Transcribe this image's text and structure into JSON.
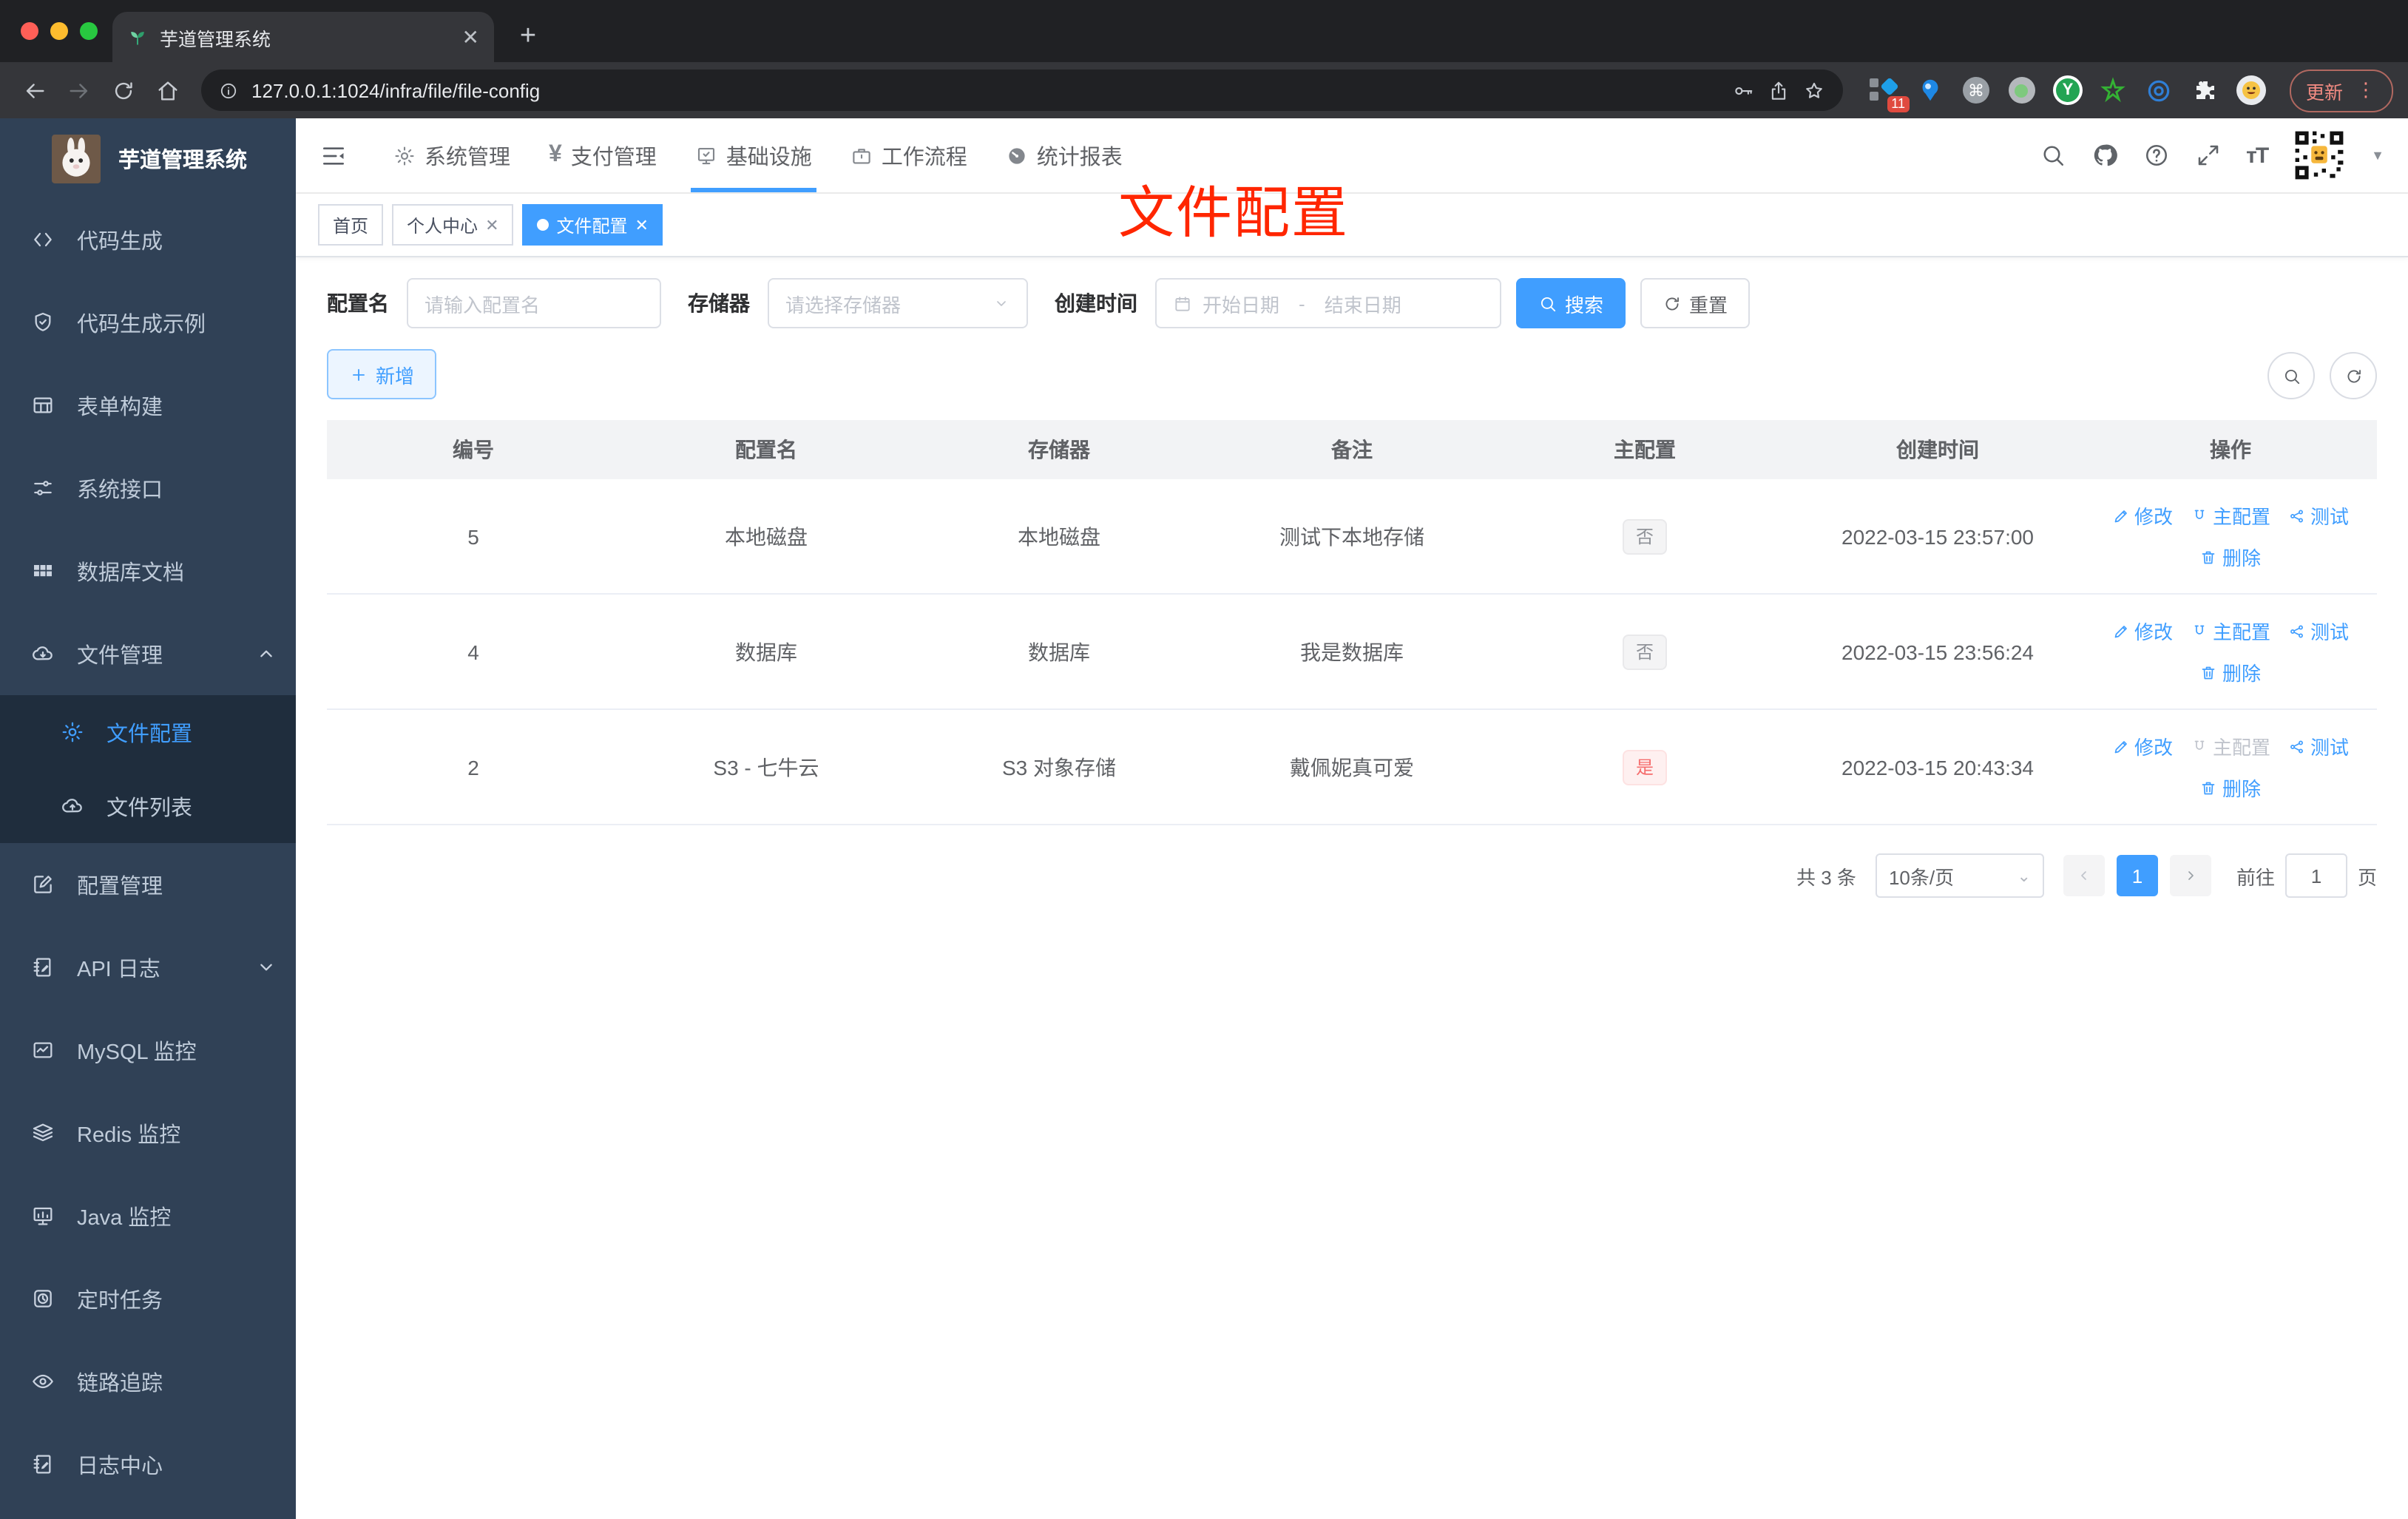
{
  "browser": {
    "tab_title": "芋道管理系统",
    "url": "127.0.0.1:1024/infra/file/file-config",
    "new_tab": "+",
    "extension_badge": "11",
    "update_label": "更新"
  },
  "sidebar": {
    "title": "芋道管理系统",
    "items": [
      {
        "label": "代码生成",
        "icon": "code"
      },
      {
        "label": "代码生成示例",
        "icon": "shield"
      },
      {
        "label": "表单构建",
        "icon": "form"
      },
      {
        "label": "系统接口",
        "icon": "sliders"
      },
      {
        "label": "数据库文档",
        "icon": "grid"
      },
      {
        "label": "文件管理",
        "icon": "cloudDown",
        "expanded": true,
        "children": [
          {
            "label": "文件配置",
            "icon": "gear",
            "active": true
          },
          {
            "label": "文件列表",
            "icon": "cloudUp"
          }
        ]
      },
      {
        "label": "配置管理",
        "icon": "edit"
      },
      {
        "label": "API 日志",
        "icon": "docEdit",
        "collapsed": true
      },
      {
        "label": "MySQL 监控",
        "icon": "chart"
      },
      {
        "label": "Redis 监控",
        "icon": "layers"
      },
      {
        "label": "Java 监控",
        "icon": "monitorBars"
      },
      {
        "label": "定时任务",
        "icon": "timer"
      },
      {
        "label": "链路追踪",
        "icon": "eye"
      },
      {
        "label": "日志中心",
        "icon": "docEdit"
      }
    ]
  },
  "topnav": {
    "items": [
      {
        "label": "系统管理",
        "icon": "gear"
      },
      {
        "label": "支付管理",
        "icon": "yen"
      },
      {
        "label": "基础设施",
        "icon": "monitorCheck",
        "active": true
      },
      {
        "label": "工作流程",
        "icon": "briefcase"
      },
      {
        "label": "统计报表",
        "icon": "gauge"
      }
    ]
  },
  "tabs": [
    {
      "label": "首页",
      "closable": false,
      "active": false
    },
    {
      "label": "个人中心",
      "closable": true,
      "active": false
    },
    {
      "label": "文件配置",
      "closable": true,
      "active": true
    }
  ],
  "annotation": "文件配置",
  "filters": {
    "name_label": "配置名",
    "name_placeholder": "请输入配置名",
    "storage_label": "存储器",
    "storage_placeholder": "请选择存储器",
    "time_label": "创建时间",
    "start_placeholder": "开始日期",
    "separator": "-",
    "end_placeholder": "结束日期",
    "search_label": "搜索",
    "reset_label": "重置"
  },
  "toolbar": {
    "add_label": "新增"
  },
  "table": {
    "columns": [
      "编号",
      "配置名",
      "存储器",
      "备注",
      "主配置",
      "创建时间",
      "操作"
    ],
    "action_labels": {
      "edit": "修改",
      "master": "主配置",
      "test": "测试",
      "delete": "删除"
    },
    "rows": [
      {
        "id": "5",
        "name": "本地磁盘",
        "storage": "本地磁盘",
        "remark": "测试下本地存储",
        "master": "否",
        "master_type": "info",
        "created": "2022-03-15 23:57:00",
        "master_disabled": false
      },
      {
        "id": "4",
        "name": "数据库",
        "storage": "数据库",
        "remark": "我是数据库",
        "master": "否",
        "master_type": "info",
        "created": "2022-03-15 23:56:24",
        "master_disabled": false
      },
      {
        "id": "2",
        "name": "S3 - 七牛云",
        "storage": "S3 对象存储",
        "remark": "戴佩妮真可爱",
        "master": "是",
        "master_type": "danger",
        "created": "2022-03-15 20:43:34",
        "master_disabled": true
      }
    ]
  },
  "pagination": {
    "total": "共 3 条",
    "page_size": "10条/页",
    "current_page": "1",
    "goto_label": "前往",
    "goto_value": "1",
    "page_label": "页"
  },
  "colors": {
    "primary": "#409eff",
    "danger": "#f56c6c",
    "annotation_red": "#ff2600",
    "sidebar_bg": "#304156",
    "sidebar_sub_bg": "#1f2d3d"
  }
}
